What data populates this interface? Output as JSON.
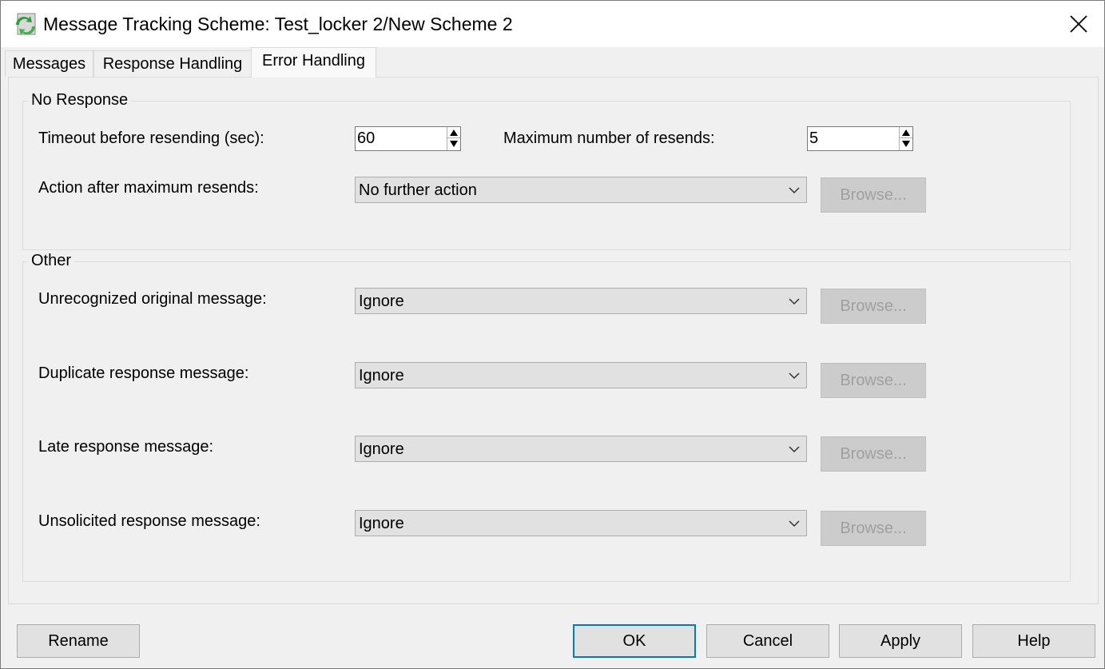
{
  "window": {
    "title": "Message Tracking Scheme: Test_locker 2/New Scheme 2",
    "icon": "arrows-refresh-app-icon",
    "close_icon": "close-icon"
  },
  "tabs": [
    {
      "label": "Messages",
      "active": false
    },
    {
      "label": "Response Handling",
      "active": false
    },
    {
      "label": "Error Handling",
      "active": true
    }
  ],
  "no_response": {
    "group_title": "No Response",
    "timeout_label": "Timeout before resending (sec):",
    "timeout_value": "60",
    "max_resends_label": "Maximum number of resends:",
    "max_resends_value": "5",
    "action_label": "Action after maximum resends:",
    "action_value": "No further action",
    "browse_label": "Browse..."
  },
  "other": {
    "group_title": "Other",
    "rows": [
      {
        "label": "Unrecognized original message:",
        "value": "Ignore",
        "browse": "Browse..."
      },
      {
        "label": "Duplicate response message:",
        "value": "Ignore",
        "browse": "Browse..."
      },
      {
        "label": "Late response message:",
        "value": "Ignore",
        "browse": "Browse..."
      },
      {
        "label": "Unsolicited response message:",
        "value": "Ignore",
        "browse": "Browse..."
      }
    ]
  },
  "footer": {
    "rename": "Rename",
    "ok": "OK",
    "cancel": "Cancel",
    "apply": "Apply",
    "help": "Help"
  },
  "colors": {
    "accent": "#0078d7",
    "dialog_bg": "#f0f0f0",
    "disabled_text": "#a0a0a0"
  }
}
